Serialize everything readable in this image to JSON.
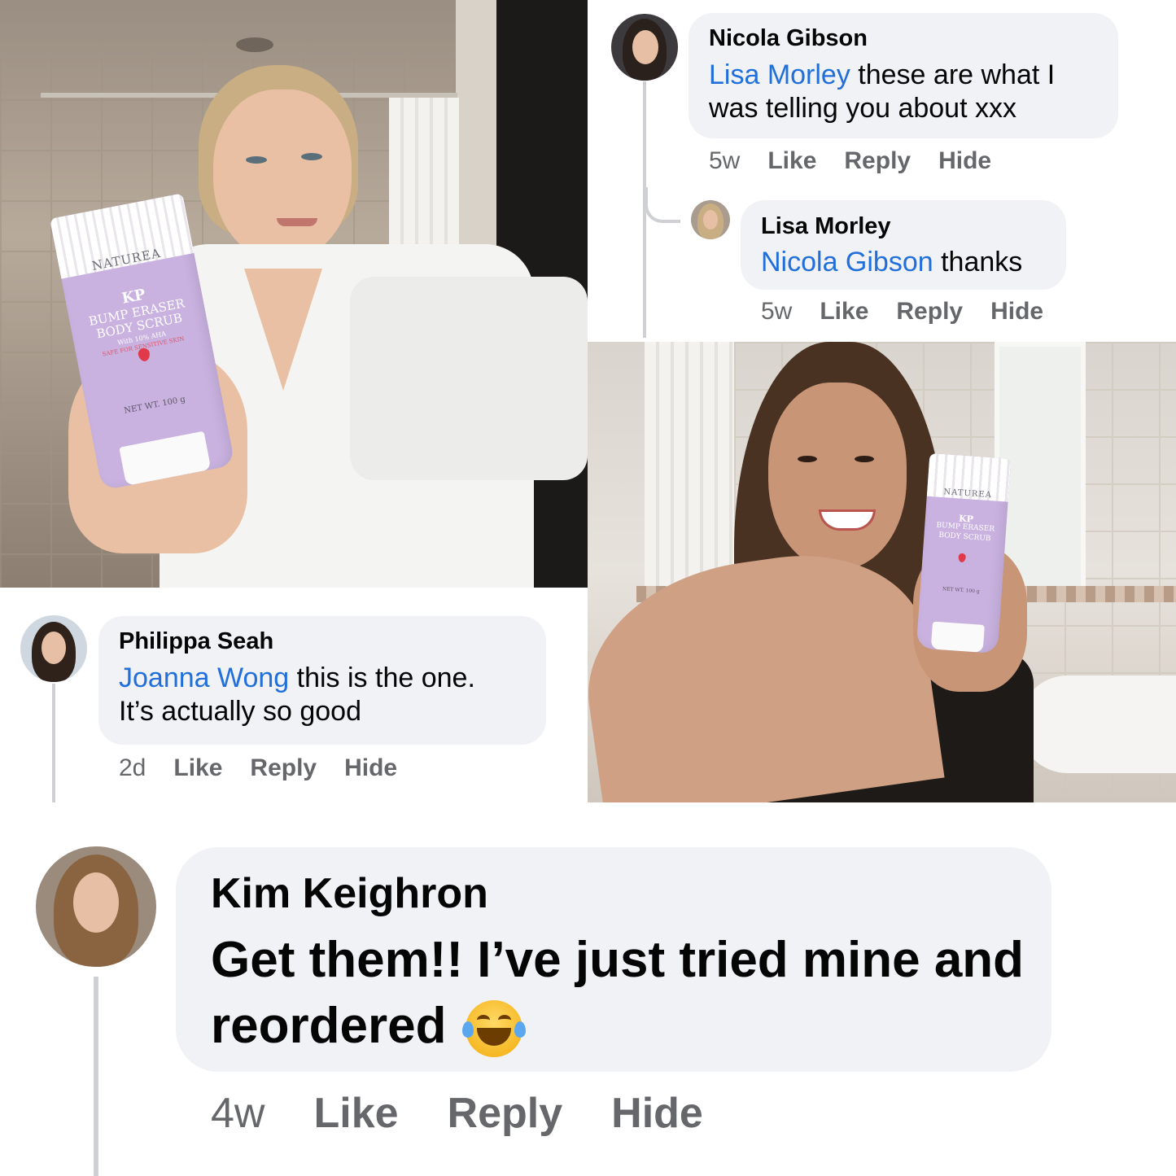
{
  "photos": {
    "photo_1": {
      "product": {
        "brand": "NATUREA",
        "kp": "KP",
        "line1": "BUMP ERASER",
        "line2": "BODY SCRUB",
        "line3": "With 10% AHA",
        "line4": "SAFE FOR SENSITIVE SKIN",
        "net": "NET WT. 100 g"
      }
    },
    "photo_2": {
      "product": {
        "brand": "NATUREA",
        "kp": "KP",
        "line1": "BUMP ERASER",
        "line2": "BODY SCRUB",
        "net": "NET WT. 100 g"
      }
    }
  },
  "comments": [
    {
      "name": "Nicola Gibson",
      "mention": "Lisa Morley",
      "text_line1": " these are what I",
      "text_line2": "was telling you about xxx",
      "time": "5w",
      "like": "Like",
      "reply": "Reply",
      "hide": "Hide"
    },
    {
      "name": "Lisa Morley",
      "mention": "Nicola Gibson",
      "text_line1": " thanks",
      "time": "5w",
      "like": "Like",
      "reply": "Reply",
      "hide": "Hide"
    },
    {
      "name": "Philippa Seah",
      "mention": "Joanna Wong",
      "text_line1": " this is the one.",
      "text_line2": "It’s actually so good",
      "time": "2d",
      "like": "Like",
      "reply": "Reply",
      "hide": "Hide"
    },
    {
      "name": "Kim Keighron",
      "text_line1": "Get them!! I’ve just tried mine and",
      "text_line2": "reordered",
      "emoji": "face-with-tears-of-joy",
      "time": "4w",
      "like": "Like",
      "reply": "Reply",
      "hide": "Hide"
    }
  ],
  "colors": {
    "bubble": "#f0f2f5",
    "mention": "#216fdb",
    "meta": "#65676b",
    "text": "#050505"
  }
}
